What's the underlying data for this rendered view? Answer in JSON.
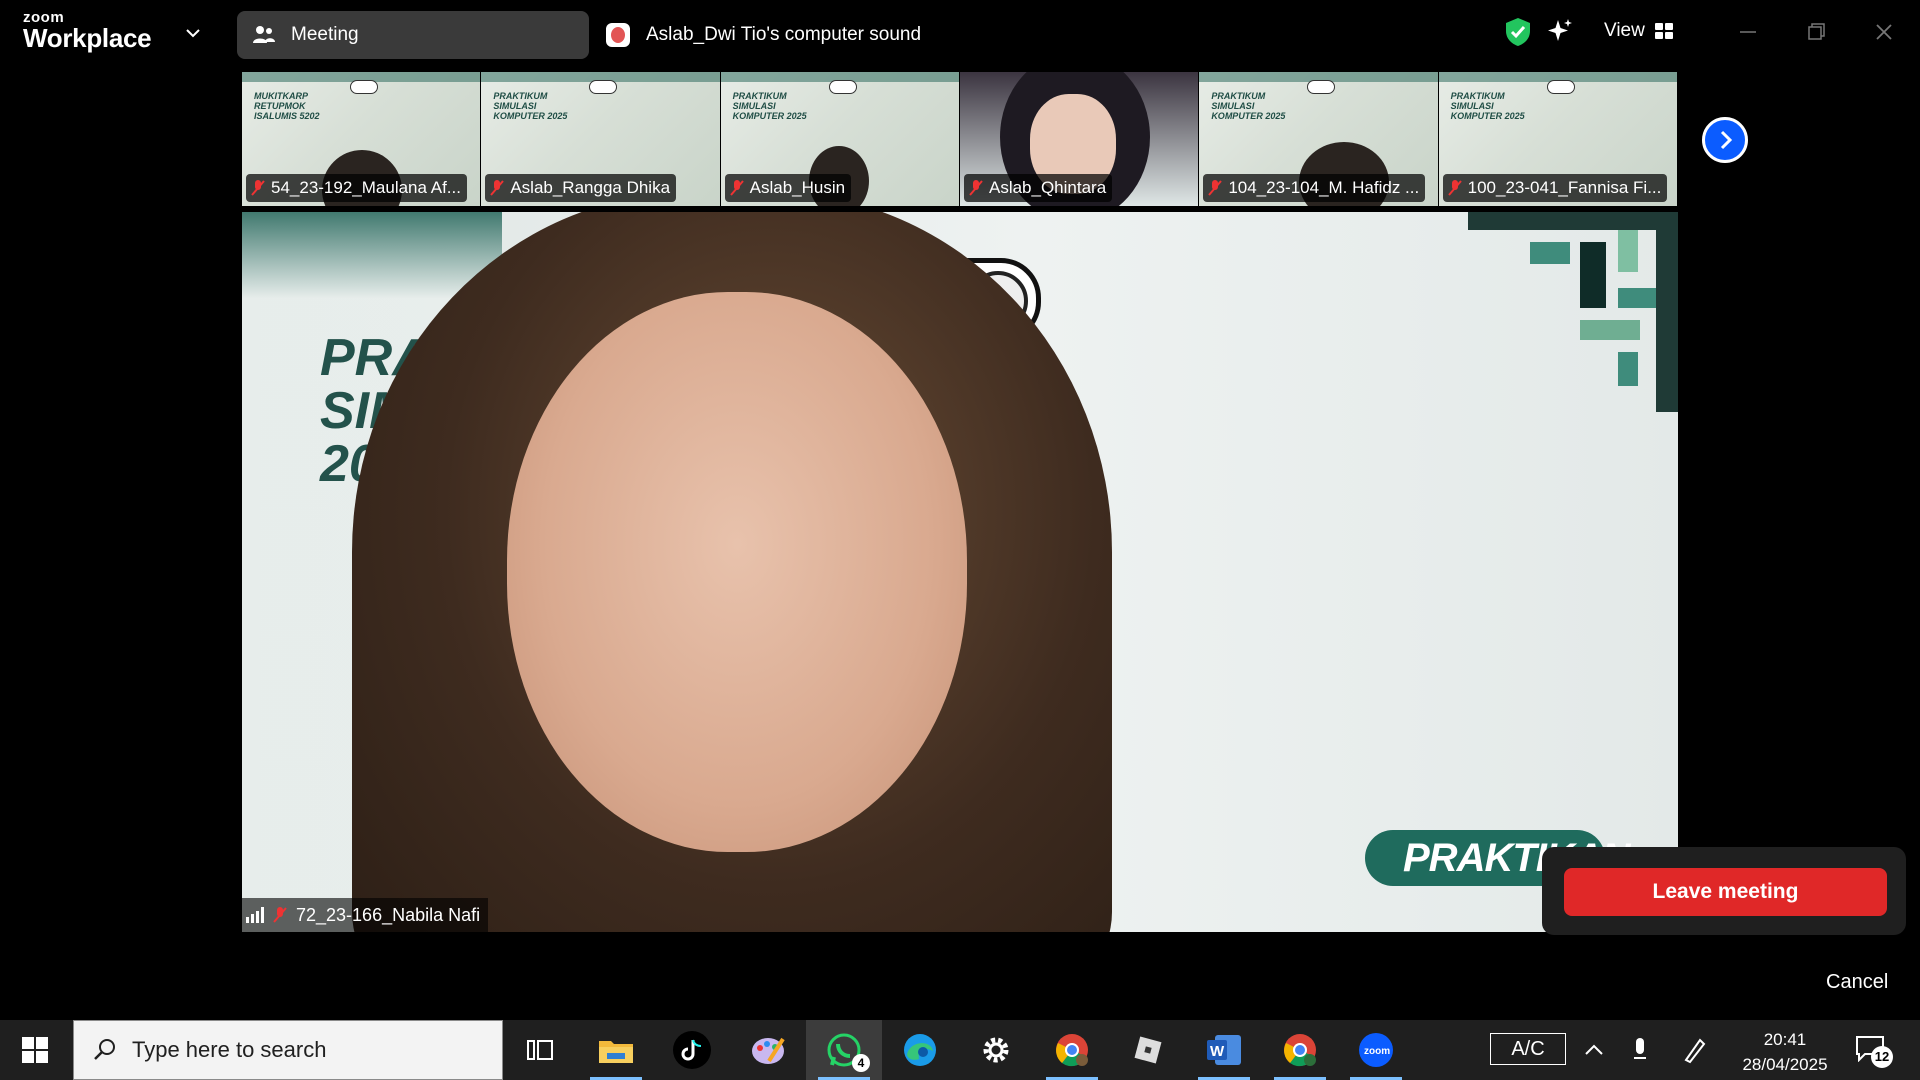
{
  "app": {
    "brand_small": "zoom",
    "brand_large": "Workplace"
  },
  "titlebar": {
    "meeting_tab": "Meeting",
    "share_tab": "Aslab_Dwi Tio's computer sound",
    "view_label": "View",
    "icons": [
      "chevron-down-icon",
      "participants-icon",
      "shield-check-icon",
      "sparkle-icon",
      "grid-view-icon",
      "minimize-icon",
      "restore-icon",
      "close-icon"
    ]
  },
  "gallery": {
    "participants": [
      {
        "name": "54_23-192_Maulana Af..."
      },
      {
        "name": "Aslab_Rangga Dhika"
      },
      {
        "name": "Aslab_Husin"
      },
      {
        "name": "Aslab_Qhintara"
      },
      {
        "name": "104_23-104_M. Hafidz ..."
      },
      {
        "name": "100_23-041_Fannisa Fi..."
      }
    ],
    "tile_text": "PRAKTIKUM SIMULASI KOMPUTER 2025",
    "tile_text_mirrored": "MUKITKARP RETUPMOK ISALUMIS 5202"
  },
  "speaker": {
    "name": "72_23-166_Nabila Nafi",
    "banner_left": [
      "PRAKT",
      "SIMU",
      "202"
    ],
    "banner_right": "PRAKTIKAN"
  },
  "leave": {
    "button": "Leave meeting",
    "cancel": "Cancel"
  },
  "taskbar": {
    "search_placeholder": "Type here to search",
    "whatsapp_badge": "4",
    "ac_label": "A/C",
    "time": "20:41",
    "date": "28/04/2025",
    "notification_count": "12"
  },
  "colors": {
    "leave_red": "#e02828",
    "zoom_blue": "#0b5cff",
    "shield_green": "#22c55e",
    "banner_green": "#1f6b5d"
  }
}
